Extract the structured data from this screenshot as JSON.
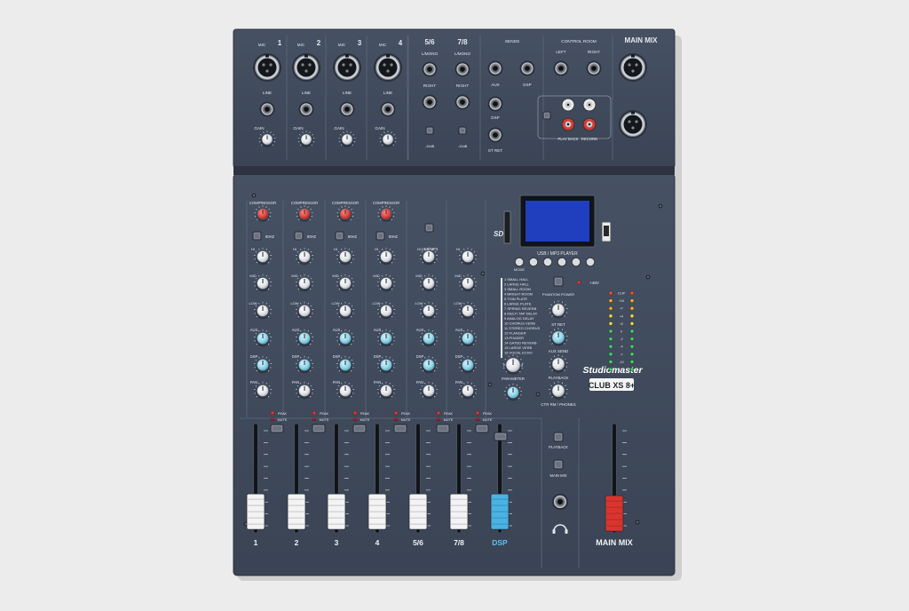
{
  "image": {
    "subject": "photo of a compact analog audio mixing console"
  },
  "colors": {
    "background": "#ececec",
    "panel": "#3e4859",
    "panel_dark": "#323a48",
    "legend": "#e6e8ee",
    "knob_white": "#eef0f2",
    "knob_cyan": "#8fd6ea",
    "knob_red": "#e2443f",
    "lcd": "#1f3fbf",
    "fader_white": "#f3f3f3",
    "fader_cyan": "#4ab2e4",
    "fader_red": "#d9352e"
  },
  "top": {
    "mic_channels": [
      "1",
      "2",
      "3",
      "4"
    ],
    "mic_label": "MIC",
    "line_label": "LINE",
    "gain_label": "GAIN",
    "stereo_channels": [
      "5/6",
      "7/8"
    ],
    "lmono_label": "L/MONO",
    "right_label": "RIGHT",
    "sends_label": "SENDS",
    "aux_label": "AUX",
    "dsp_label": "DSP",
    "st_ret_label": "ST RET",
    "control_room_label": "CONTROL ROOM",
    "left_label": "LEFT",
    "record_label": "RECORD",
    "play_label": "PLAY BACK",
    "main_mix_label": "MAIN MIX"
  },
  "channel_strip": {
    "compressor_label": "COMPRESSOR",
    "hz_label": "80HZ",
    "eq_labels": [
      "HI",
      "MID",
      "LOW"
    ],
    "aux_label": "AUX",
    "dsp_label": "DSP",
    "pan_label": "PAN",
    "peak_label": "PEAK",
    "mute_label": "MUTE",
    "usb_label": "USB/MP3"
  },
  "fader_labels": [
    "1",
    "2",
    "3",
    "4",
    "5/6",
    "7/8",
    "DSP",
    "MAIN MIX"
  ],
  "fader_levels": [
    0.12,
    0.12,
    0.12,
    0.12,
    0.12,
    0.12,
    0.12,
    0.1
  ],
  "fx": {
    "program_label": "PROGRAM",
    "parameter_label": "PARAMETER",
    "programs": [
      "1 SMALL HALL",
      "2 LARGE HALL",
      "3 SMALL ROOM",
      "4 BRIGHT ROOM",
      "5 THIN PLATE",
      "6 LARGE PLATE",
      "7 SPRING REVERB",
      "8 MULTI TAP DELAY",
      "9 ANALOG DELAY",
      "10 CHORUS VERB",
      "11 STEREO CHORUS",
      "12 FLANGER",
      "13 PHASER",
      "14 GATED REVERB",
      "15 LARGE VERB",
      "16 VOCAL ECHO"
    ]
  },
  "player": {
    "label": "USB / MP3 PLAYER",
    "mode_label": "MODE",
    "phantom_label": "PHANTOM POWER",
    "phantom_voltage": "+48V"
  },
  "master": {
    "st_ret_label": "ST RET",
    "aux_send_label": "AUX SEND",
    "playback_label": "PLAYBACK",
    "phones_label": "CTR RM / PHONES",
    "main_mix_btn_label": "MAIN MIX"
  },
  "brand": {
    "name": "Studiomaster",
    "model": "CLUB XS 8+"
  },
  "meter_labels": [
    "CLIP",
    "+10",
    "+7",
    "+4",
    "+2",
    "0",
    "-2",
    "-4",
    "-7",
    "-10",
    "-20"
  ]
}
